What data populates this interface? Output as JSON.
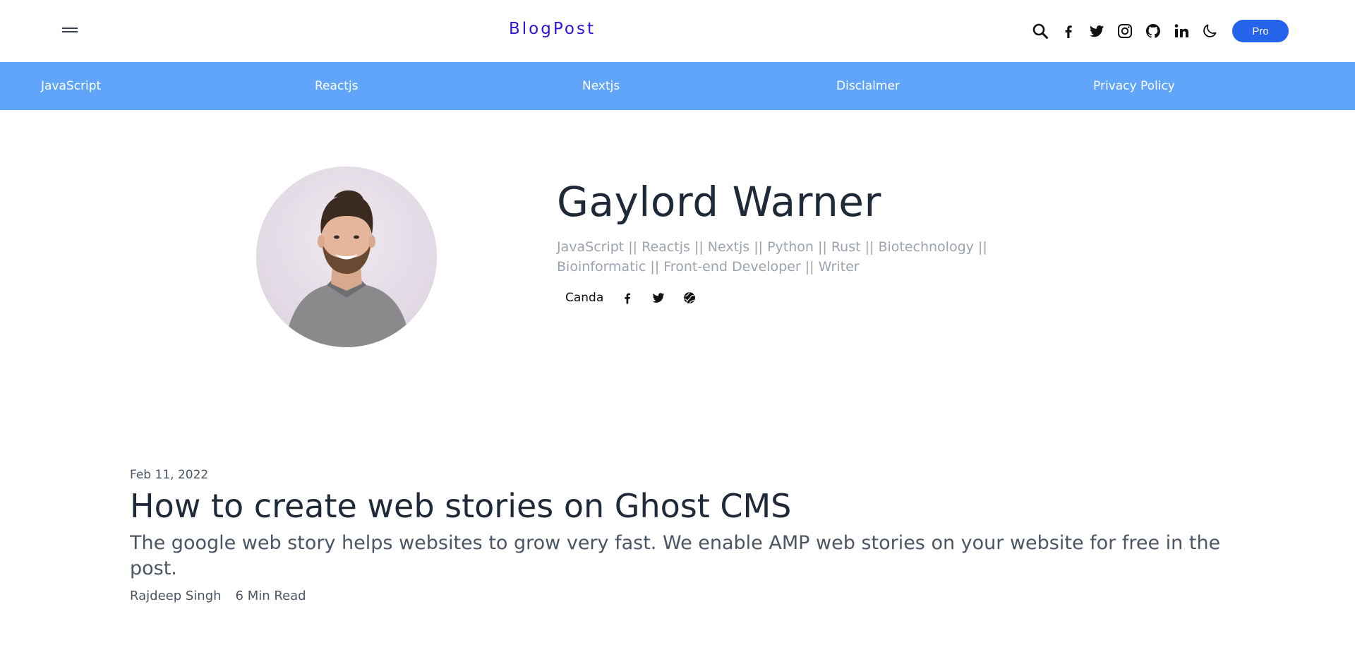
{
  "header": {
    "logo": "BlogPost",
    "pro_label": "Pro",
    "icons": [
      "search-icon",
      "facebook-icon",
      "twitter-icon",
      "instagram-icon",
      "github-icon",
      "linkedin-icon",
      "moon-icon"
    ]
  },
  "nav": {
    "items": [
      {
        "label": "JavaScript"
      },
      {
        "label": "Reactjs"
      },
      {
        "label": "Nextjs"
      },
      {
        "label": "Disclalmer"
      },
      {
        "label": "Privacy Policy"
      }
    ]
  },
  "profile": {
    "name": "Gaylord Warner",
    "bio": "JavaScript || Reactjs || Nextjs || Python || Rust || Biotechnology || Bioinformatic || Front-end Developer || Writer",
    "location": "Canda",
    "icons": [
      "facebook-icon",
      "twitter-icon",
      "website-icon"
    ]
  },
  "post": {
    "date": "Feb 11, 2022",
    "title": "How to create web stories on Ghost CMS",
    "description": "The google web story helps websites to grow very fast. We enable AMP web stories on your website for free in the post.",
    "author": "Rajdeep Singh",
    "read_time": "6 Min Read"
  },
  "colors": {
    "logo": "#2b15d8",
    "nav_bg": "#60a5fa",
    "pro_button": "#2563eb"
  }
}
